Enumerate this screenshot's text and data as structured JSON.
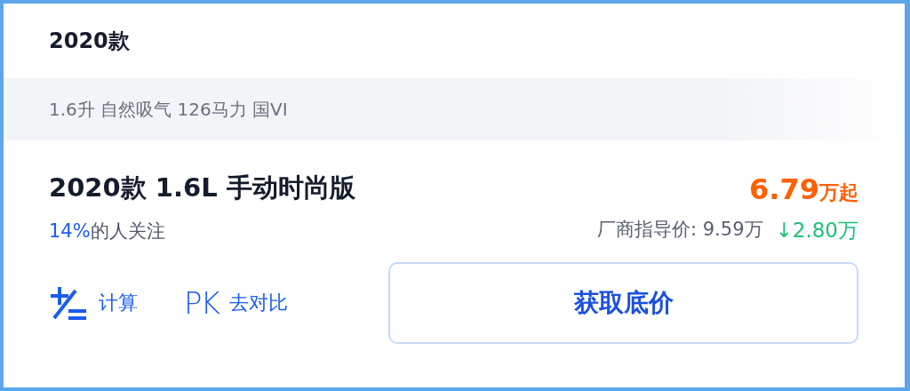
{
  "year_heading": "2020款",
  "spec_band": "1.6升 自然吸气 126马力 国VI",
  "model": {
    "name": "2020款 1.6L 手动时尚版",
    "attention_percent": "14%",
    "attention_text": "的人关注",
    "price": "6.79",
    "price_unit": "万起",
    "guide_price": "厂商指导价: 9.59万",
    "drop_arrow": "↓",
    "drop": "2.80万"
  },
  "actions": [
    {
      "kind": "calculator",
      "label": "计算"
    },
    {
      "kind": "pk",
      "icon_text": "PK",
      "label": "去对比"
    }
  ],
  "primary_button": "获取底价"
}
